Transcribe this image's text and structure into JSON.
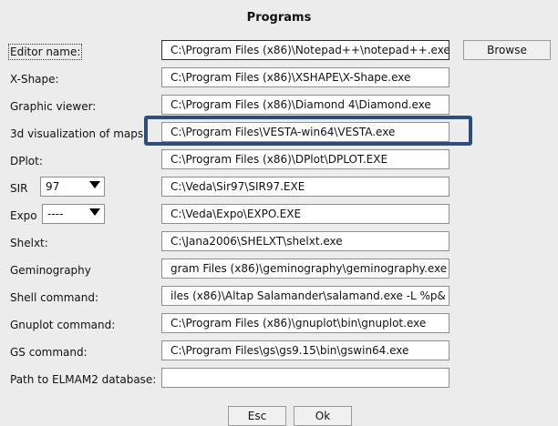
{
  "dialog": {
    "title": "Programs"
  },
  "rows": [
    {
      "label": "Editor name:",
      "value": "C:\\Program Files (x86)\\Notepad++\\notepad++.exe"
    },
    {
      "label": "X-Shape:",
      "value": "C:\\Program Files (x86)\\XSHAPE\\X-Shape.exe"
    },
    {
      "label": "Graphic viewer:",
      "value": "C:\\Program Files (x86)\\Diamond 4\\Diamond.exe"
    },
    {
      "label": "3d visualization of maps:",
      "value": "C:\\Program Files\\VESTA-win64\\VESTA.exe"
    },
    {
      "label": "DPlot:",
      "value": "C:\\Program Files (x86)\\DPlot\\DPLOT.EXE"
    },
    {
      "label": "SIR",
      "combo_value": "97",
      "value": "C:\\Veda\\Sir97\\SIR97.EXE"
    },
    {
      "label": "Expo",
      "combo_value": "----",
      "value": "C:\\Veda\\Expo\\EXPO.EXE"
    },
    {
      "label": "Shelxt:",
      "value": "C:\\Jana2006\\SHELXT\\shelxt.exe"
    },
    {
      "label": "Geminography",
      "value": "gram Files (x86)\\geminography\\geminography.exe"
    },
    {
      "label": "Shell command:",
      "value": "iles (x86)\\Altap Salamander\\salamand.exe -L %p&"
    },
    {
      "label": "Gnuplot command:",
      "value": "C:\\Program Files (x86)\\gnuplot\\bin\\gnuplot.exe"
    },
    {
      "label": "GS command:",
      "value": "C:\\Program Files\\gs\\gs9.15\\bin\\gswin64.exe"
    },
    {
      "label": "Path to ELMAM2 database:",
      "value": ""
    }
  ],
  "buttons": {
    "browse": "Browse",
    "esc": "Esc",
    "ok": "Ok"
  },
  "colors": {
    "highlight": "#2d4d7c",
    "background": "#ececec"
  }
}
